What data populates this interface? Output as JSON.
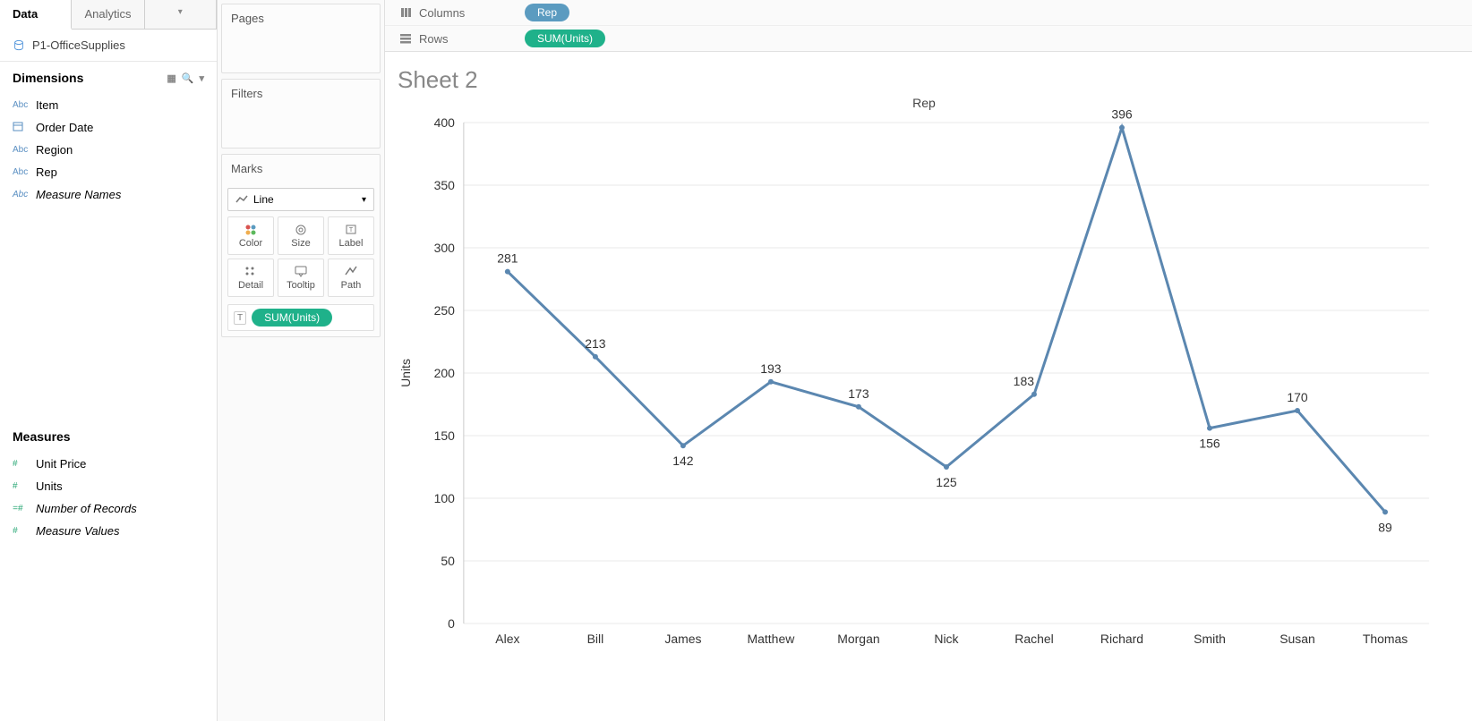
{
  "tabs": {
    "data": "Data",
    "analytics": "Analytics"
  },
  "datasource": {
    "name": "P1-OfficeSupplies"
  },
  "dimensions": {
    "header": "Dimensions",
    "items": [
      {
        "icon": "Abc",
        "label": "Item"
      },
      {
        "icon": "cal",
        "label": "Order Date"
      },
      {
        "icon": "Abc",
        "label": "Region"
      },
      {
        "icon": "Abc",
        "label": "Rep"
      },
      {
        "icon": "Abc",
        "label": "Measure Names",
        "italic": true
      }
    ]
  },
  "measures": {
    "header": "Measures",
    "items": [
      {
        "icon": "#",
        "label": "Unit Price"
      },
      {
        "icon": "#",
        "label": "Units"
      },
      {
        "icon": "=#",
        "label": "Number of Records",
        "italic": true
      },
      {
        "icon": "#",
        "label": "Measure Values",
        "italic": true
      }
    ]
  },
  "shelves": {
    "pages": "Pages",
    "filters": "Filters",
    "marks": "Marks",
    "mark_type": "Line",
    "cells": {
      "color": "Color",
      "size": "Size",
      "label": "Label",
      "detail": "Detail",
      "tooltip": "Tooltip",
      "path": "Path"
    },
    "label_pill": "SUM(Units)"
  },
  "colrows": {
    "columns": "Columns",
    "rows": "Rows",
    "col_pill": "Rep",
    "row_pill": "SUM(Units)"
  },
  "sheet_title": "Sheet 2",
  "chart_data": {
    "type": "line",
    "title": "Rep",
    "ylabel": "Units",
    "xlabel": "",
    "ylim": [
      0,
      400
    ],
    "yticks": [
      0,
      50,
      100,
      150,
      200,
      250,
      300,
      350,
      400
    ],
    "categories": [
      "Alex",
      "Bill",
      "James",
      "Matthew",
      "Morgan",
      "Nick",
      "Rachel",
      "Richard",
      "Smith",
      "Susan",
      "Thomas"
    ],
    "values": [
      281,
      213,
      142,
      193,
      173,
      125,
      183,
      396,
      156,
      170,
      89
    ]
  }
}
